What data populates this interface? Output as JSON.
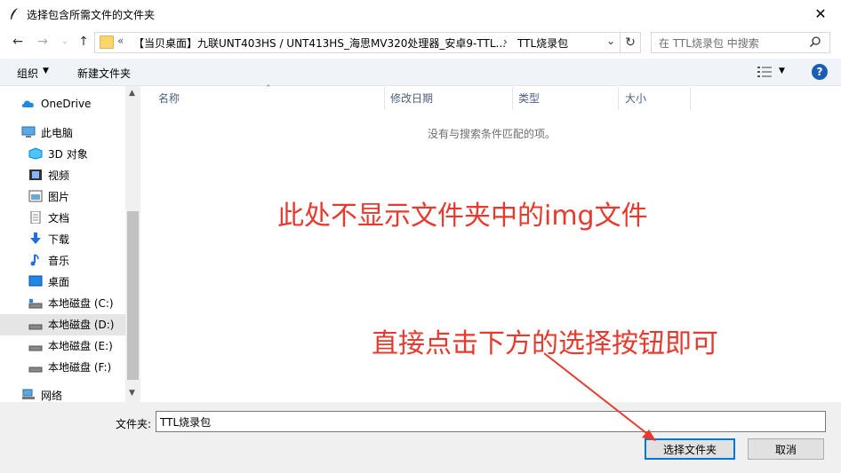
{
  "window": {
    "title": "选择包含所需文件的文件夹",
    "close_label": "✕"
  },
  "address": {
    "overflow": "«",
    "path": "【当贝桌面】九联UNT403HS / UNT413HS_海思MV320处理器_安卓9-TTL...",
    "separator": "›",
    "current": "TTL烧录包"
  },
  "search": {
    "placeholder": "在 TTL烧录包 中搜索"
  },
  "toolbar": {
    "organize": "组织",
    "new_folder": "新建文件夹"
  },
  "nav": {
    "items": [
      {
        "label": "OneDrive",
        "icon": "cloud-icon"
      },
      {
        "label": "此电脑",
        "icon": "pc-icon"
      },
      {
        "label": "3D 对象",
        "icon": "cube-icon"
      },
      {
        "label": "视频",
        "icon": "video-icon"
      },
      {
        "label": "图片",
        "icon": "picture-icon"
      },
      {
        "label": "文档",
        "icon": "document-icon"
      },
      {
        "label": "下载",
        "icon": "download-icon"
      },
      {
        "label": "音乐",
        "icon": "music-icon"
      },
      {
        "label": "桌面",
        "icon": "desktop-icon"
      },
      {
        "label": "本地磁盘 (C:)",
        "icon": "drive-icon"
      },
      {
        "label": "本地磁盘 (D:)",
        "icon": "drive-icon"
      },
      {
        "label": "本地磁盘 (E:)",
        "icon": "drive-icon"
      },
      {
        "label": "本地磁盘 (F:)",
        "icon": "drive-icon"
      },
      {
        "label": "网络",
        "icon": "network-icon"
      }
    ],
    "selected": "本地磁盘 (D:)"
  },
  "list": {
    "columns": [
      "名称",
      "修改日期",
      "类型",
      "大小"
    ],
    "empty_message": "没有与搜索条件匹配的项。"
  },
  "annotations": {
    "note1": "此处不显示文件夹中的img文件",
    "note2": "直接点击下方的选择按钮即可"
  },
  "footer": {
    "folder_label": "文件夹:",
    "folder_value": "TTL烧录包",
    "select_button": "选择文件夹",
    "cancel_button": "取消"
  },
  "colors": {
    "annotation": "#e8392e",
    "accent": "#0078d7"
  }
}
